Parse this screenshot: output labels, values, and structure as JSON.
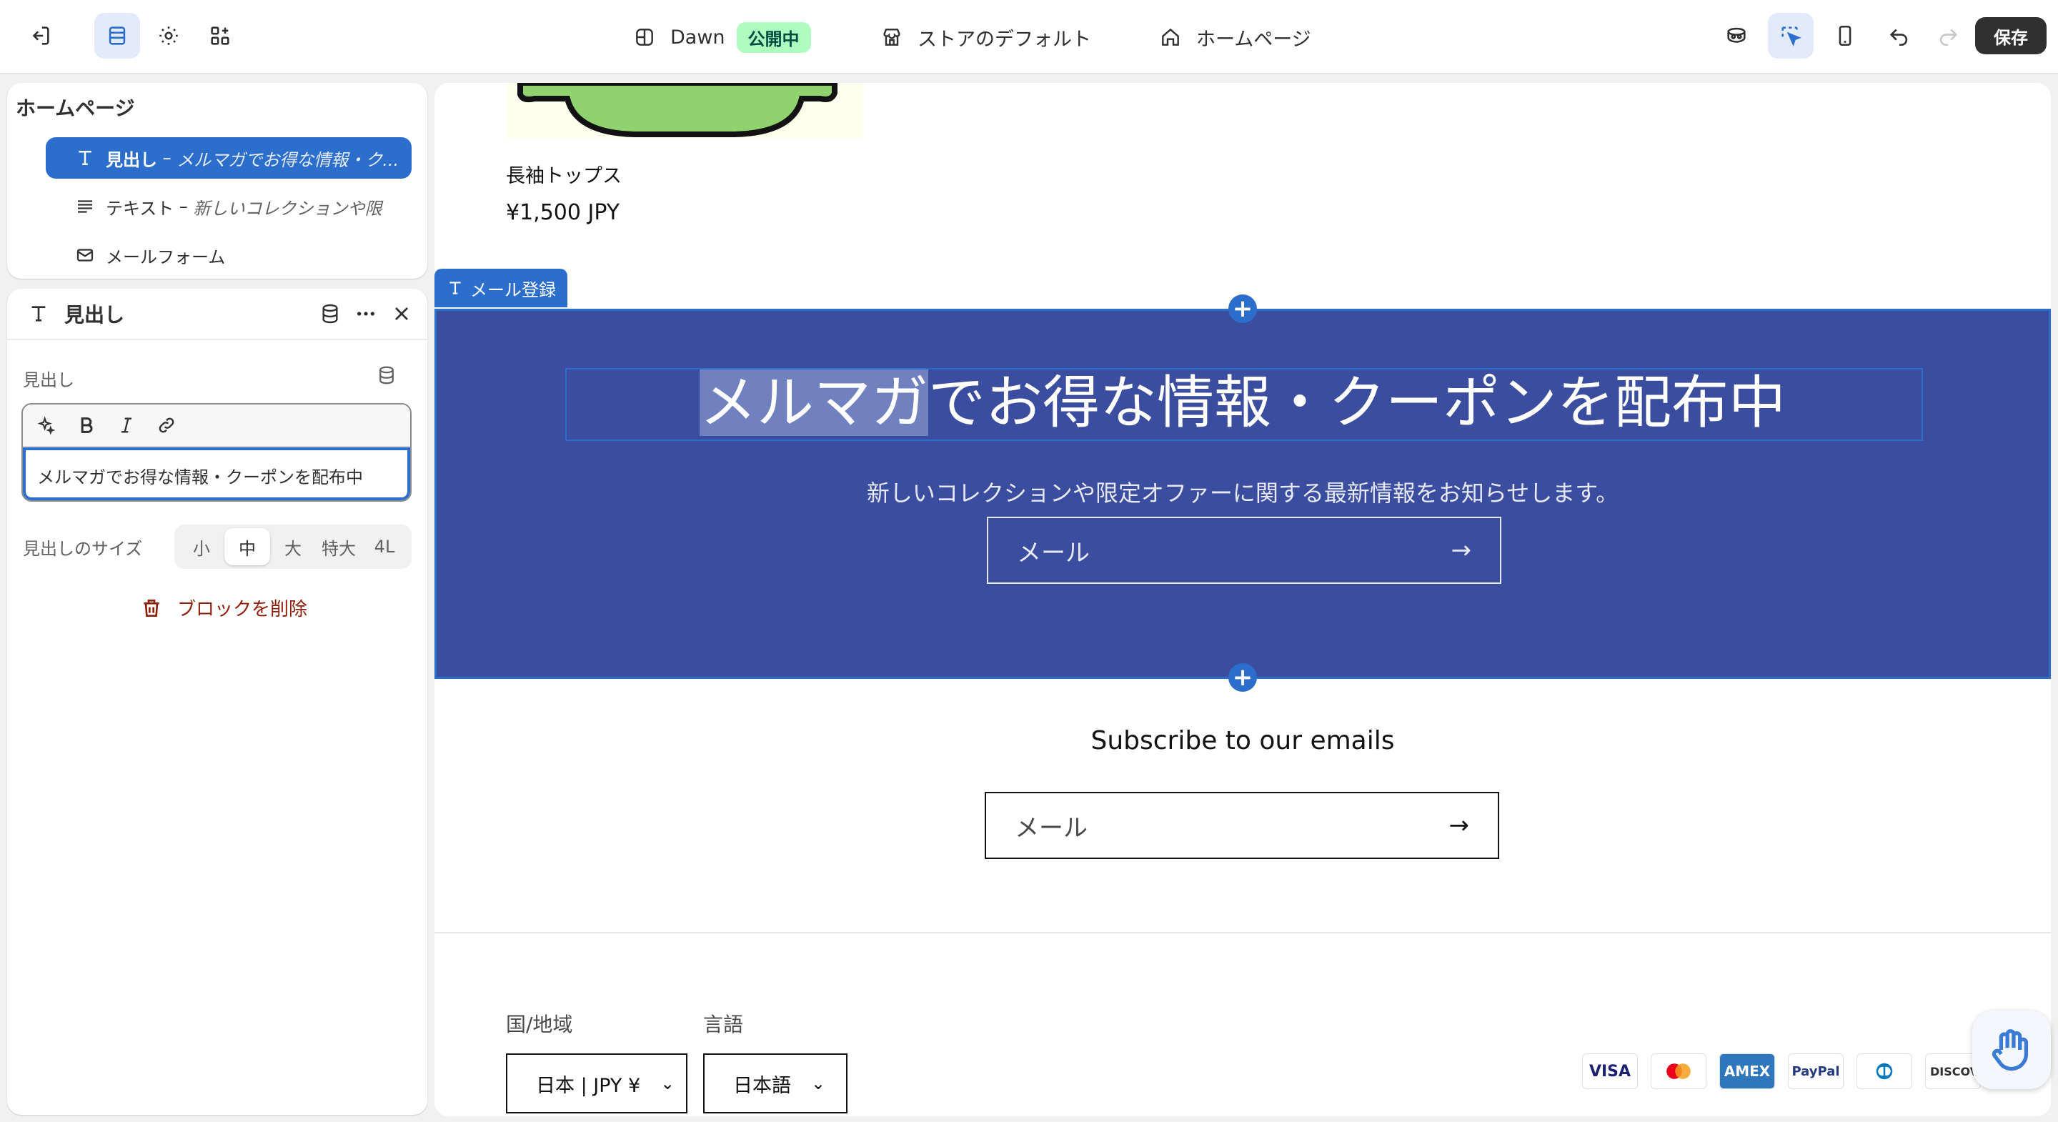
{
  "topbar": {
    "theme_name": "Dawn",
    "theme_status": "公開中",
    "store_default": "ストアのデフォルト",
    "page": "ホームページ",
    "save_label": "保存"
  },
  "tree": {
    "title": "ホームページ",
    "items": [
      {
        "name": "見出し",
        "sep": " – ",
        "detail": "メルマガでお得な情報・ク..."
      },
      {
        "name": "テキスト",
        "sep": " – ",
        "detail": "新しいコレクションや限"
      },
      {
        "name": "メールフォーム",
        "sep": "",
        "detail": ""
      }
    ]
  },
  "settings": {
    "title": "見出し",
    "field_label": "見出し",
    "field_value": "メルマガでお得な情報・クーポンを配布中",
    "size_label": "見出しのサイズ",
    "sizes": [
      "小",
      "中",
      "大",
      "特大",
      "4L"
    ],
    "selected_size": "中",
    "delete_label": "ブロックを削除"
  },
  "preview": {
    "product_name": "長袖トップス",
    "product_price": "¥1,500 JPY",
    "section_tag": "メール登録",
    "newsletter": {
      "heading_highlight": "メルマガ",
      "heading_rest": "でお得な情報・クーポンを配布中",
      "subtext": "新しいコレクションや限定オファーに関する最新情報をお知らせします。",
      "email_placeholder": "メール",
      "background": "#3b4d9e"
    },
    "subscribe": {
      "title": "Subscribe to our emails",
      "email_placeholder": "メール"
    },
    "footer": {
      "country_label": "国/地域",
      "country_value": "日本 | JPY ¥",
      "language_label": "言語",
      "language_value": "日本語",
      "payments": [
        "VISA",
        "mastercard-icon",
        "AMEX",
        "PayPal",
        "diners-icon",
        "DISCOVER"
      ]
    }
  },
  "colors": {
    "accent": "#2c6ecb",
    "delete": "#8e1f0b",
    "live_badge_bg": "#affebf"
  }
}
